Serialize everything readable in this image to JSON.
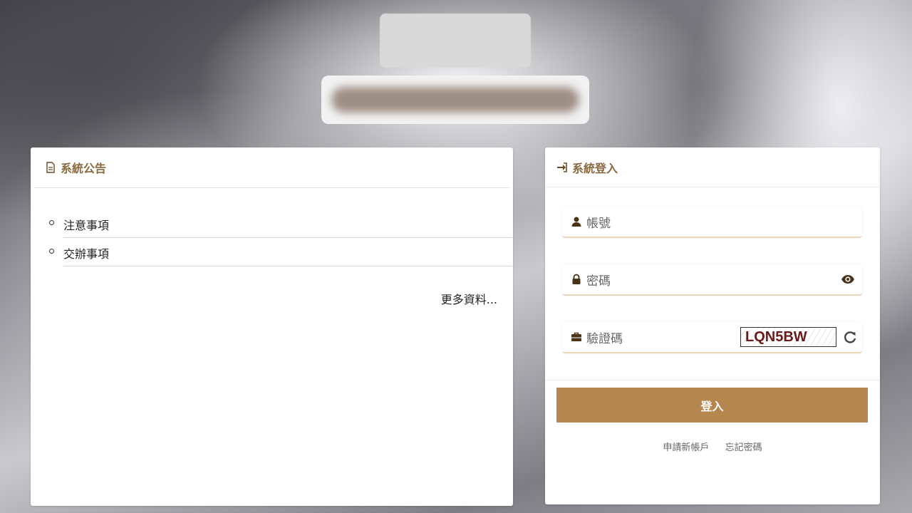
{
  "announcements": {
    "title": "系統公告",
    "items": [
      {
        "label": "注意事項"
      },
      {
        "label": "交辦事項"
      }
    ],
    "more": "更多資料..."
  },
  "login": {
    "title": "系統登入",
    "account_label": "帳號",
    "password_label": "密碼",
    "captcha_label": "驗證碼",
    "captcha_code": "LQN5BW",
    "submit_label": "登入",
    "register_link": "申請新帳戶",
    "forgot_link": "忘記密碼"
  },
  "colors": {
    "accent": "#b5864d",
    "header_text": "#8a6a40"
  },
  "icons": {
    "announce": "document-icon",
    "login": "sign-in-icon",
    "account": "user-icon",
    "password": "lock-icon",
    "captcha": "briefcase-icon",
    "show_password": "eye-icon",
    "refresh": "refresh-icon"
  }
}
